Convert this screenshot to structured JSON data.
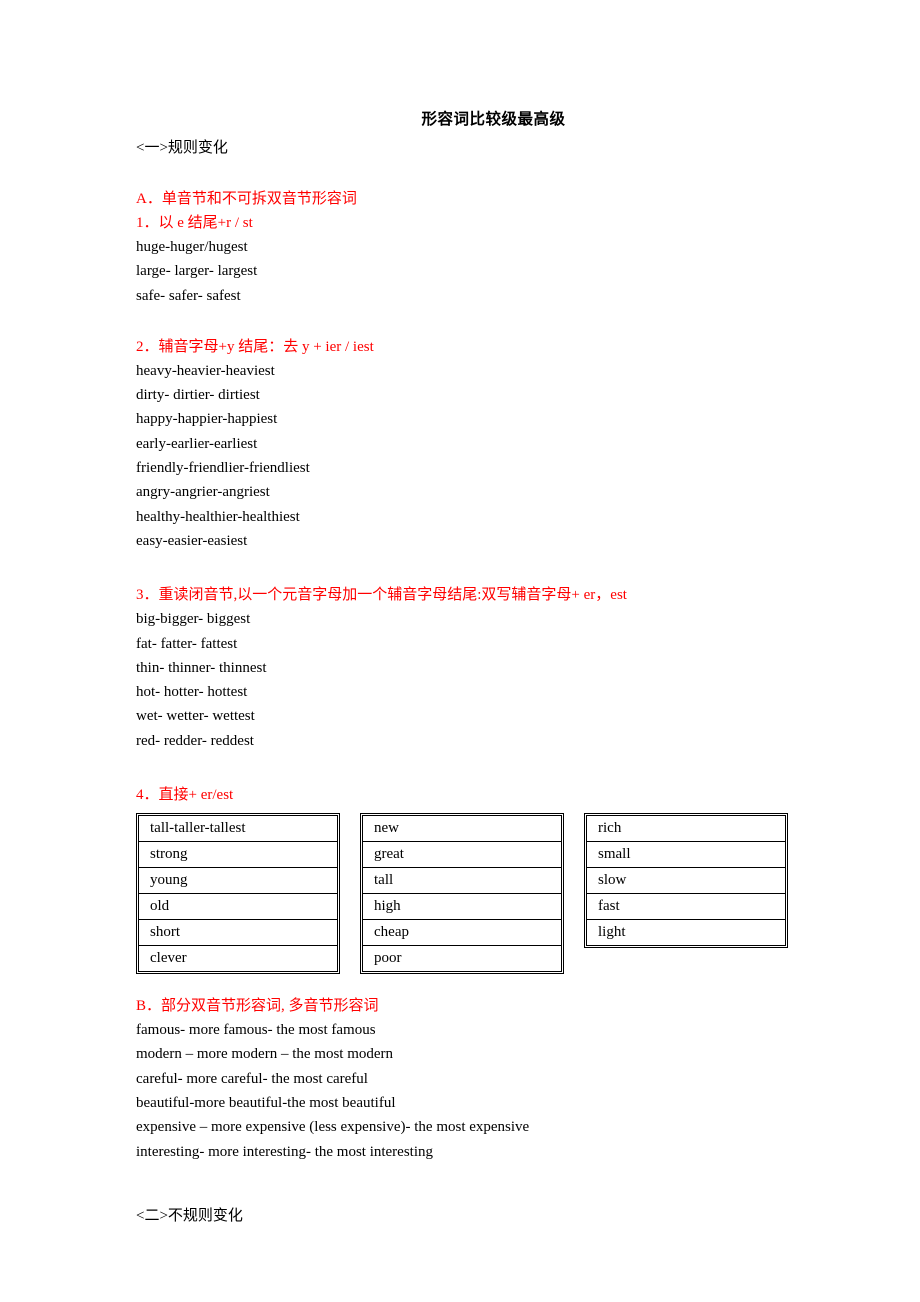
{
  "document": {
    "title": "形容词比较级最高级",
    "section_one_heading": "<一>规则变化",
    "section_two_heading": "<二>不规则变化"
  },
  "colors": {
    "rule_heading_red": "#ff0000",
    "body_text": "#000000",
    "page_background": "#ffffff",
    "table_border": "#000000"
  },
  "sections": {
    "A": {
      "heading": "A．单音节和不可拆双音节形容词",
      "rules": [
        {
          "heading": "1．以 e 结尾+r / st",
          "words": [
            "huge-huger/hugest",
            "large- larger- largest",
            "safe- safer- safest"
          ]
        },
        {
          "heading": "2．辅音字母+y 结尾：去 y + ier / iest",
          "words": [
            "heavy-heavier-heaviest",
            "dirty- dirtier- dirtiest",
            "happy-happier-happiest",
            "early-earlier-earliest",
            "friendly-friendlier-friendliest",
            "angry-angrier-angriest",
            "healthy-healthier-healthiest",
            "easy-easier-easiest"
          ]
        },
        {
          "heading": "3．重读闭音节,以一个元音字母加一个辅音字母结尾:双写辅音字母+ er，est",
          "words": [
            "big-bigger- biggest",
            "fat- fatter- fattest",
            "thin- thinner- thinnest",
            "hot- hotter- hottest",
            "wet- wetter- wettest",
            "red- redder- reddest"
          ]
        },
        {
          "heading": "4．直接+ er/est",
          "words": []
        }
      ],
      "tables": [
        {
          "name": "column-1",
          "cells": [
            "tall-taller-tallest",
            "strong",
            "young",
            "old",
            "short",
            "clever"
          ]
        },
        {
          "name": "column-2",
          "cells": [
            "new",
            "great",
            "tall",
            "high",
            "cheap",
            "poor"
          ]
        },
        {
          "name": "column-3",
          "cells": [
            "rich",
            "small",
            "slow",
            "fast",
            "light"
          ]
        }
      ]
    },
    "B": {
      "heading": "B．部分双音节形容词, 多音节形容词",
      "words": [
        "famous- more famous- the most famous",
        "modern – more modern – the most modern",
        "careful- more careful- the most careful",
        "beautiful-more beautiful-the most beautiful",
        "expensive – more expensive (less expensive)- the most expensive",
        "interesting- more interesting- the most interesting"
      ]
    }
  }
}
